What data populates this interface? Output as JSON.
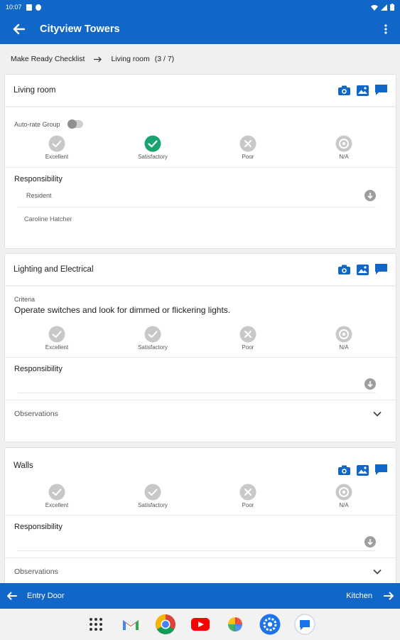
{
  "status_bar": {
    "time": "10:07"
  },
  "app_bar": {
    "title": "Cityview Towers"
  },
  "breadcrumb": {
    "root": "Make Ready Checklist",
    "current": "Living room",
    "count": "(3 / 7)"
  },
  "rating_labels": [
    "Excellent",
    "Satisfactory",
    "Poor",
    "N/A"
  ],
  "cards": [
    {
      "title": "Living room",
      "auto_rate_label": "Auto-rate Group",
      "auto_rate_enabled": false,
      "selected_rating": "Satisfactory",
      "responsibility_title": "Responsibility",
      "responsibility_value": "Resident",
      "assignee": "Caroline Hatcher"
    },
    {
      "title": "Lighting and Electrical",
      "criteria_label": "Criteria",
      "criteria_text": "Operate switches and look for dimmed or flickering lights.",
      "responsibility_title": "Responsibility",
      "observations_label": "Observations"
    },
    {
      "title": "Walls",
      "responsibility_title": "Responsibility",
      "observations_label": "Observations"
    }
  ],
  "bottom_nav": {
    "prev_label": "Entry Door",
    "next_label": "Kitchen"
  },
  "dock_apps": [
    "app-drawer-icon",
    "gmail-icon",
    "chrome-icon",
    "youtube-icon",
    "photos-icon",
    "settings-icon",
    "messages-icon"
  ],
  "colors": {
    "primary": "#1167c7",
    "selected": "#1aa36f",
    "unselected": "#c8c8c8"
  }
}
